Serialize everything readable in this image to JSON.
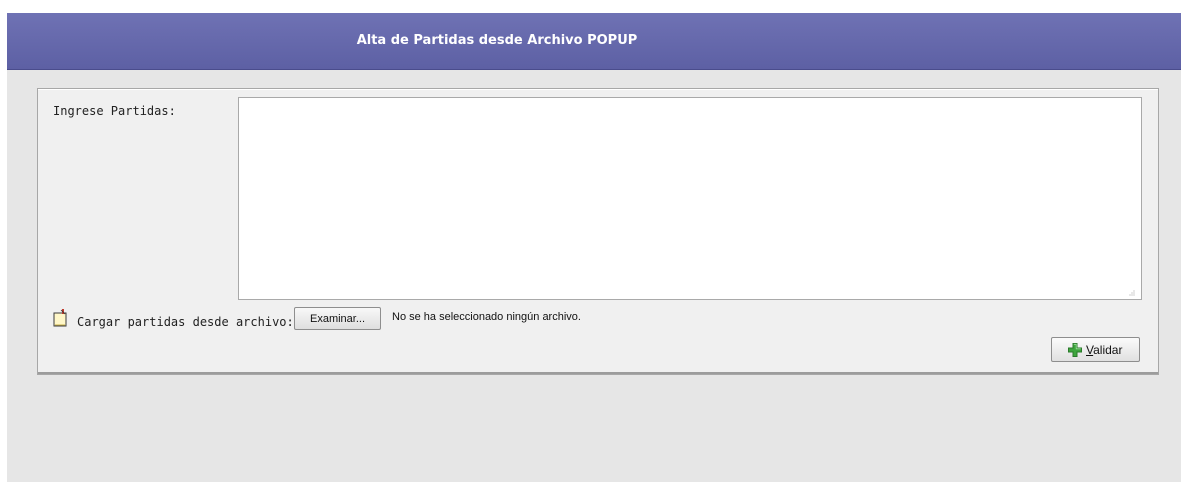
{
  "popup": {
    "title": "Alta de Partidas desde Archivo POPUP"
  },
  "form": {
    "partidas_label": "Ingrese Partidas:",
    "partidas_value": "",
    "upload_label": "Cargar partidas desde archivo:",
    "upload_icon": "new-document-icon",
    "browse_button_label": "Examinar...",
    "file_status": "No se ha seleccionado ningún archivo.",
    "validate_button": {
      "mnemonic": "V",
      "rest": "alidar",
      "icon": "green-plus-icon"
    }
  },
  "colors": {
    "titlebar": "#5d60a4",
    "background": "#e6e6e6",
    "panel": "#f0f0f0",
    "plus_icon": "#3da53d"
  }
}
